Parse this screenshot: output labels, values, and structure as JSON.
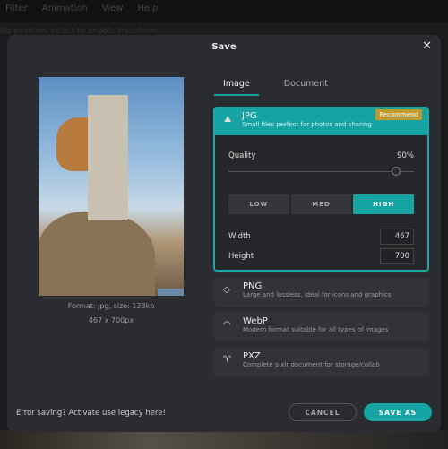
{
  "menubar": {
    "items": [
      "Filter",
      "Animation",
      "View",
      "Help"
    ]
  },
  "background_hint": "No position, select to enable transform",
  "dialog": {
    "title": "Save",
    "close_icon": "close-icon",
    "preview": {
      "format_info": "Format: jpg, size: 123kb",
      "dimensions": "467 x 700px"
    },
    "legacy_link": "Error saving? Activate use legacy here!",
    "tabs": [
      {
        "label": "Image",
        "active": true
      },
      {
        "label": "Document",
        "active": false
      }
    ],
    "jpg": {
      "name": "JPG",
      "description": "Small files perfect for photos and sharing",
      "badge": "Recommend",
      "icon": "image-icon",
      "quality_label": "Quality",
      "quality_value": "90%",
      "quality": 90,
      "levels": [
        "LOW",
        "MED",
        "HIGH"
      ],
      "selected_level": "HIGH",
      "width_label": "Width",
      "width": "467",
      "height_label": "Height",
      "height": "700"
    },
    "formats": [
      {
        "name": "PNG",
        "description": "Large and lossless, ideal for icons and graphics",
        "icon": "shapes-icon"
      },
      {
        "name": "WebP",
        "description": "Modern format suitable for all types of images",
        "icon": "webp-icon"
      },
      {
        "name": "PXZ",
        "description": "Complete pixlr document for storage/collab",
        "icon": "sprout-icon"
      }
    ],
    "cancel": "CANCEL",
    "save_as": "SAVE AS",
    "accent": "#16a3a3"
  }
}
